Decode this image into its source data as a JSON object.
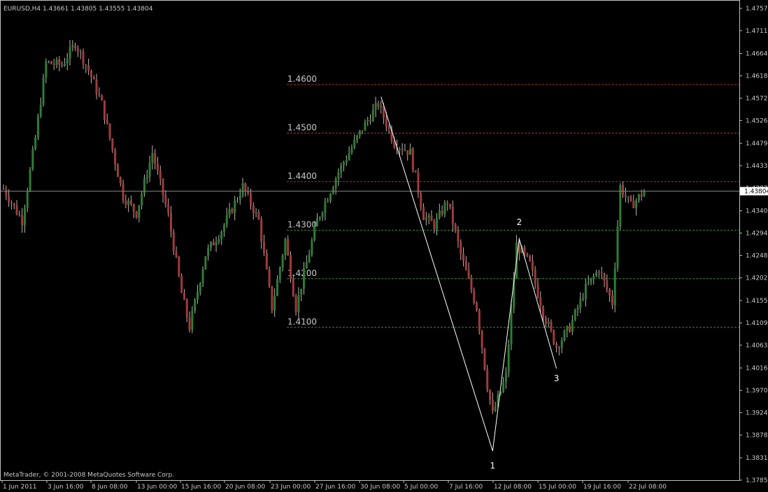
{
  "header": {
    "symbol_line": "EURUSD,H4  1.43661 1.43805 1.43555 1.43804"
  },
  "footer": {
    "copyright": "MetaTrader, © 2001-2008 MetaQuotes Software Corp."
  },
  "colors": {
    "background": "#000000",
    "frame": "#c0c0c0",
    "text": "#c8c8c8",
    "bull_candle": "#2e7d32",
    "bear_candle": "#a33a3a",
    "wick": "#b8b8b8",
    "level_red": "#b03030",
    "level_green": "#2e8b2e",
    "wave_line": "#ffffff",
    "bid_line": "#808080"
  },
  "chart_data": {
    "type": "candlestick",
    "symbol": "EURUSD",
    "timeframe": "H4",
    "ohlc_current": {
      "open": 1.43661,
      "high": 1.43805,
      "low": 1.43555,
      "close": 1.43804
    },
    "ylim": [
      1.3785,
      1.4757
    ],
    "yticks": [
      "1.47570",
      "1.47110",
      "1.46640",
      "1.46180",
      "1.45720",
      "1.45260",
      "1.44790",
      "1.44330",
      "1.43870",
      "1.43400",
      "1.42940",
      "1.42480",
      "1.42020",
      "1.41550",
      "1.41090",
      "1.40630",
      "1.40160",
      "1.39700",
      "1.39240",
      "1.38780",
      "1.38310",
      "1.37850"
    ],
    "current_price_label": "1.43804",
    "xticks": [
      "1 Jun 2011",
      "3 Jun 16:00",
      "8 Jun 08:00",
      "13 Jun 00:00",
      "15 Jun 16:00",
      "20 Jun 08:00",
      "23 Jun 00:00",
      "27 Jun 16:00",
      "30 Jun 08:00",
      "5 Jul 00:00",
      "7 Jul 16:00",
      "12 Jul 08:00",
      "15 Jul 00:00",
      "19 Jul 16:00",
      "22 Jul 08:00"
    ],
    "levels": [
      {
        "price": 1.46,
        "label": "1.4600",
        "color": "red"
      },
      {
        "price": 1.45,
        "label": "1.4500",
        "color": "red"
      },
      {
        "price": 1.44,
        "label": "1.4400",
        "color": "red"
      },
      {
        "price": 1.43,
        "label": "1.4300",
        "color": "green"
      },
      {
        "price": 1.42,
        "label": "1.4200",
        "color": "green"
      },
      {
        "price": 1.41,
        "label": "1.4100",
        "color": "green"
      }
    ],
    "anchors": [
      {
        "t": 0,
        "p": 1.4385
      },
      {
        "t": 7,
        "p": 1.432
      },
      {
        "t": 12,
        "p": 1.449
      },
      {
        "t": 16,
        "p": 1.4645
      },
      {
        "t": 22,
        "p": 1.464
      },
      {
        "t": 27,
        "p": 1.4685
      },
      {
        "t": 32,
        "p": 1.463
      },
      {
        "t": 37,
        "p": 1.456
      },
      {
        "t": 45,
        "p": 1.437
      },
      {
        "t": 50,
        "p": 1.4335
      },
      {
        "t": 56,
        "p": 1.446
      },
      {
        "t": 62,
        "p": 1.433
      },
      {
        "t": 67,
        "p": 1.417
      },
      {
        "t": 70,
        "p": 1.41
      },
      {
        "t": 76,
        "p": 1.425
      },
      {
        "t": 82,
        "p": 1.43
      },
      {
        "t": 90,
        "p": 1.439
      },
      {
        "t": 96,
        "p": 1.432
      },
      {
        "t": 101,
        "p": 1.414
      },
      {
        "t": 106,
        "p": 1.428
      },
      {
        "t": 110,
        "p": 1.414
      },
      {
        "t": 113,
        "p": 1.421
      },
      {
        "t": 118,
        "p": 1.432
      },
      {
        "t": 126,
        "p": 1.442
      },
      {
        "t": 135,
        "p": 1.451
      },
      {
        "t": 141,
        "p": 1.456
      },
      {
        "t": 147,
        "p": 1.448
      },
      {
        "t": 153,
        "p": 1.446
      },
      {
        "t": 158,
        "p": 1.433
      },
      {
        "t": 162,
        "p": 1.431
      },
      {
        "t": 167,
        "p": 1.436
      },
      {
        "t": 172,
        "p": 1.425
      },
      {
        "t": 178,
        "p": 1.414
      },
      {
        "t": 182,
        "p": 1.398
      },
      {
        "t": 184,
        "p": 1.392
      },
      {
        "t": 189,
        "p": 1.4
      },
      {
        "t": 193,
        "p": 1.427
      },
      {
        "t": 198,
        "p": 1.423
      },
      {
        "t": 203,
        "p": 1.413
      },
      {
        "t": 208,
        "p": 1.406
      },
      {
        "t": 213,
        "p": 1.41
      },
      {
        "t": 219,
        "p": 1.418
      },
      {
        "t": 224,
        "p": 1.422
      },
      {
        "t": 229,
        "p": 1.415
      },
      {
        "t": 232,
        "p": 1.439
      },
      {
        "t": 236,
        "p": 1.435
      },
      {
        "t": 241,
        "p": 1.438
      }
    ],
    "wave_labels": [
      {
        "text": "1",
        "price": 1.3835,
        "t": 184
      },
      {
        "text": "2",
        "price": 1.4282,
        "t": 194
      },
      {
        "text": "3",
        "price": 1.4015,
        "t": 208
      }
    ],
    "wave_points": [
      {
        "t": 142,
        "p": 1.4575
      },
      {
        "t": 184,
        "p": 1.3845
      },
      {
        "t": 194,
        "p": 1.4282
      },
      {
        "t": 208,
        "p": 1.4015
      }
    ]
  }
}
